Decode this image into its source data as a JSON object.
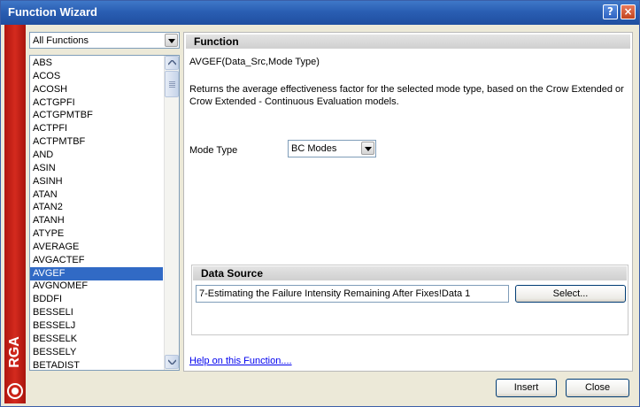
{
  "window": {
    "title": "Function Wizard",
    "help_glyph": "?",
    "close_glyph": "×"
  },
  "brand": {
    "text": "RGA",
    "color": "#c41e14"
  },
  "category_select": {
    "value": "All Functions"
  },
  "function_list": {
    "items": [
      "ABS",
      "ACOS",
      "ACOSH",
      "ACTGPFI",
      "ACTGPMTBF",
      "ACTPFI",
      "ACTPMTBF",
      "AND",
      "ASIN",
      "ASINH",
      "ATAN",
      "ATAN2",
      "ATANH",
      "ATYPE",
      "AVERAGE",
      "AVGACTEF",
      "AVGEF",
      "AVGNOMEF",
      "BDDFI",
      "BESSELI",
      "BESSELJ",
      "BESSELK",
      "BESSELY",
      "BETADIST"
    ],
    "selected": "AVGEF",
    "selected_color": "#316ac5"
  },
  "function_panel": {
    "header": "Function",
    "signature": "AVGEF(Data_Src,Mode Type)",
    "description": "Returns the average effectiveness factor for the selected mode type, based on the Crow Extended or Crow Extended - Continuous Evaluation models.",
    "mode_type_label": "Mode Type",
    "mode_type_value": "BC Modes"
  },
  "data_source": {
    "header": "Data Source",
    "value": "7-Estimating the Failure Intensity Remaining After Fixes!Data 1",
    "select_label": "Select..."
  },
  "help_link": "Help on this Function....",
  "buttons": {
    "insert": "Insert",
    "close": "Close"
  }
}
